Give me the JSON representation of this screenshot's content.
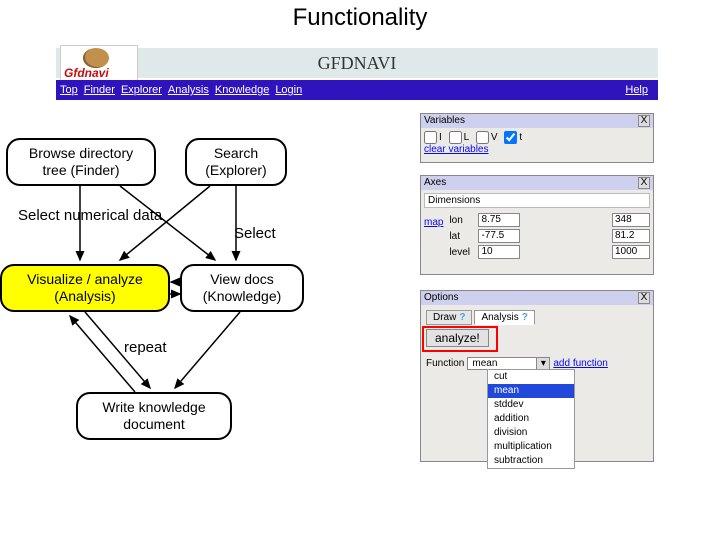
{
  "page_title": "Functionality",
  "banner": {
    "logo_text": "Gfdnavi",
    "title": "GFDNAVI"
  },
  "nav": {
    "items": [
      "Top",
      "Finder",
      "Explorer",
      "Analysis",
      "Knowledge",
      "Login"
    ],
    "help": "Help"
  },
  "flow": {
    "browse": {
      "l1": "Browse directory",
      "l2": "tree (Finder)"
    },
    "search": {
      "l1": "Search",
      "l2": "(Explorer)"
    },
    "visualize": {
      "l1": "Visualize / analyze",
      "l2": "(Analysis)"
    },
    "viewdocs": {
      "l1": "View docs",
      "l2": "(Knowledge)"
    },
    "write": {
      "l1": "Write knowledge",
      "l2": "document"
    },
    "sel_num": "Select numerical data",
    "select": "Select",
    "repeat": "repeat"
  },
  "variables": {
    "title": "Variables",
    "checks": [
      "I",
      "L",
      "V",
      "t"
    ],
    "clear": "clear variables"
  },
  "axes": {
    "title": "Axes",
    "sub": "Dimensions",
    "map_link": "map",
    "rows": [
      {
        "name": "lon",
        "a": "8.75",
        "b": "348"
      },
      {
        "name": "lat",
        "a": "-77.5",
        "b": "81.2"
      },
      {
        "name": "level",
        "a": "10",
        "b": "1000"
      }
    ]
  },
  "options": {
    "title": "Options",
    "tab_draw": "Draw",
    "tab_analysis": "Analysis",
    "analyze_btn": "analyze!",
    "func_label": "Function",
    "func_selected": "mean",
    "add_func": "add function",
    "menu": [
      "cut",
      "mean",
      "stddev",
      "addition",
      "division",
      "multiplication",
      "subtraction"
    ]
  }
}
